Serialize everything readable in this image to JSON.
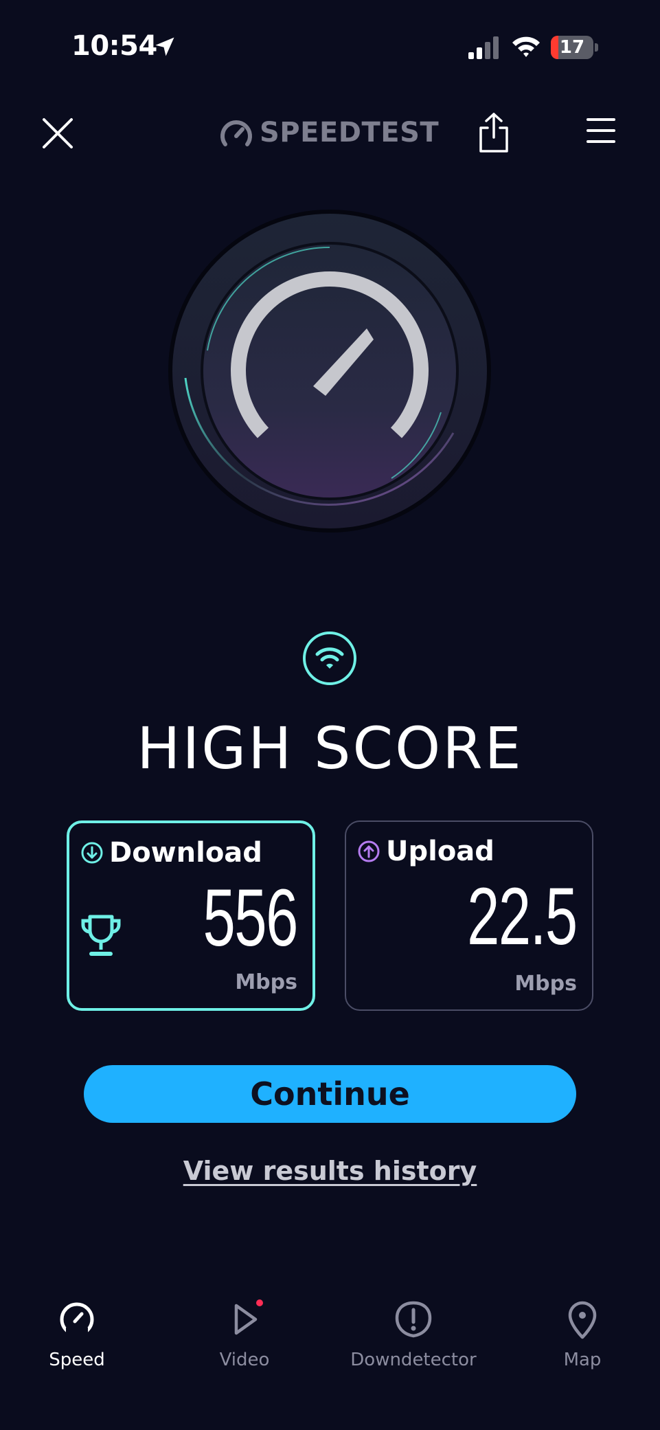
{
  "status_bar": {
    "time": "10:54",
    "battery_level": "17",
    "battery_fraction": 0.17,
    "battery_color": "#ff3b30"
  },
  "header": {
    "logo_text": "SPEEDTEST",
    "icons": [
      "close-icon",
      "speedtest-logo-icon",
      "share-icon",
      "menu-icon"
    ]
  },
  "result": {
    "title": "HIGH SCORE",
    "badge_icon": "wifi-icon"
  },
  "download": {
    "label": "Download",
    "value": "556",
    "unit": "Mbps",
    "accent": "#6ff0e6",
    "badge_icon": "trophy-icon"
  },
  "upload": {
    "label": "Upload",
    "value": "22.5",
    "unit": "Mbps",
    "accent": "#b57cf0"
  },
  "actions": {
    "continue_label": "Continue",
    "history_label": "View results history",
    "continue_color": "#1fb1ff"
  },
  "tabbar": {
    "items": [
      {
        "label": "Speed",
        "icon": "speedometer-icon",
        "active": true
      },
      {
        "label": "Video",
        "icon": "play-icon",
        "active": false,
        "has_dot": true
      },
      {
        "label": "Downdetector",
        "icon": "alert-icon",
        "active": false
      },
      {
        "label": "Map",
        "icon": "map-pin-icon",
        "active": false
      }
    ]
  }
}
